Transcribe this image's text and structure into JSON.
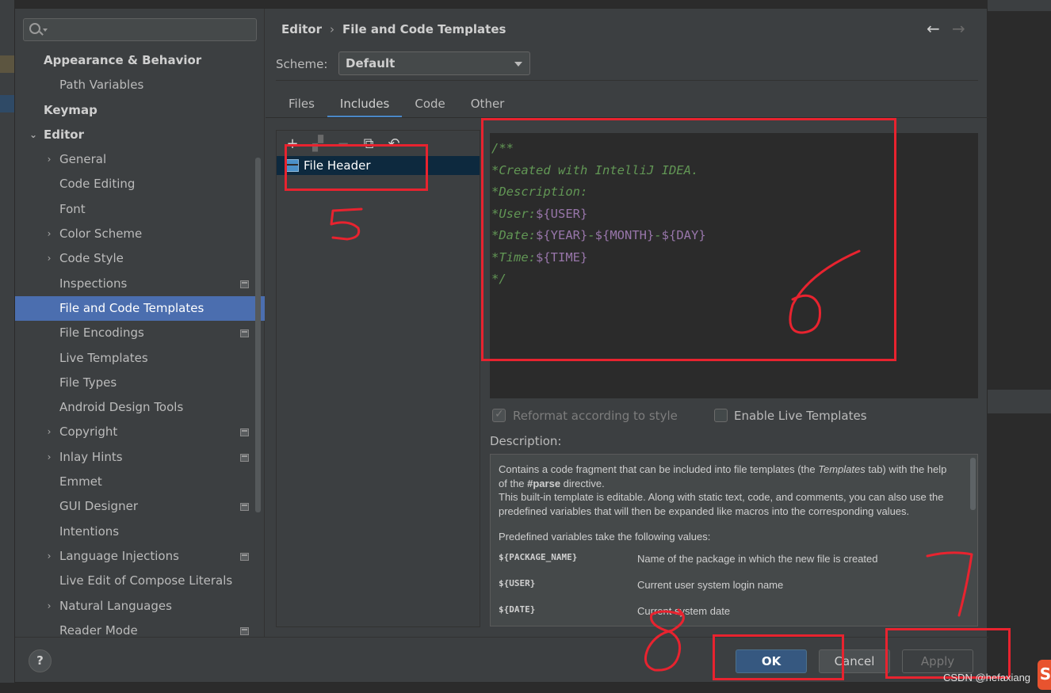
{
  "search": {
    "placeholder": ""
  },
  "sidebar": {
    "items": [
      {
        "label": "Appearance & Behavior",
        "level": 0,
        "arrow": "",
        "proj": false
      },
      {
        "label": "Path Variables",
        "level": 1,
        "arrow": "",
        "proj": false
      },
      {
        "label": "Keymap",
        "level": 0,
        "arrow": "",
        "proj": false
      },
      {
        "label": "Editor",
        "level": 0,
        "arrow": "⌄",
        "proj": false
      },
      {
        "label": "General",
        "level": 1,
        "arrow": "›",
        "proj": false
      },
      {
        "label": "Code Editing",
        "level": 1,
        "arrow": "",
        "proj": false
      },
      {
        "label": "Font",
        "level": 1,
        "arrow": "",
        "proj": false
      },
      {
        "label": "Color Scheme",
        "level": 1,
        "arrow": "›",
        "proj": false
      },
      {
        "label": "Code Style",
        "level": 1,
        "arrow": "›",
        "proj": false
      },
      {
        "label": "Inspections",
        "level": 1,
        "arrow": "",
        "proj": true
      },
      {
        "label": "File and Code Templates",
        "level": 1,
        "arrow": "",
        "proj": false,
        "selected": true
      },
      {
        "label": "File Encodings",
        "level": 1,
        "arrow": "",
        "proj": true
      },
      {
        "label": "Live Templates",
        "level": 1,
        "arrow": "",
        "proj": false
      },
      {
        "label": "File Types",
        "level": 1,
        "arrow": "",
        "proj": false
      },
      {
        "label": "Android Design Tools",
        "level": 1,
        "arrow": "",
        "proj": false
      },
      {
        "label": "Copyright",
        "level": 1,
        "arrow": "›",
        "proj": true
      },
      {
        "label": "Inlay Hints",
        "level": 1,
        "arrow": "›",
        "proj": true
      },
      {
        "label": "Emmet",
        "level": 1,
        "arrow": "",
        "proj": false
      },
      {
        "label": "GUI Designer",
        "level": 1,
        "arrow": "",
        "proj": true
      },
      {
        "label": "Intentions",
        "level": 1,
        "arrow": "",
        "proj": false
      },
      {
        "label": "Language Injections",
        "level": 1,
        "arrow": "›",
        "proj": true
      },
      {
        "label": "Live Edit of Compose Literals",
        "level": 1,
        "arrow": "",
        "proj": false
      },
      {
        "label": "Natural Languages",
        "level": 1,
        "arrow": "›",
        "proj": false
      },
      {
        "label": "Reader Mode",
        "level": 1,
        "arrow": "",
        "proj": true
      }
    ]
  },
  "header": {
    "crumb1": "Editor",
    "sep": "›",
    "crumb2": "File and Code Templates",
    "back": "←",
    "forward": "→"
  },
  "scheme": {
    "label": "Scheme:",
    "value": "Default"
  },
  "tabs": [
    "Files",
    "Includes",
    "Code",
    "Other"
  ],
  "toolbar": {
    "add": "+",
    "copy_disabled": "▞",
    "remove": "−",
    "duplicate": "⧉",
    "reset": "↶"
  },
  "list": {
    "selected_item": "File Header"
  },
  "editor": {
    "lines": [
      [
        {
          "t": "/**",
          "k": "comment"
        }
      ],
      [
        {
          "t": "*Created with IntelliJ IDEA.",
          "k": "comment"
        }
      ],
      [
        {
          "t": "*Description:",
          "k": "comment"
        }
      ],
      [
        {
          "t": "*User:",
          "k": "comment"
        },
        {
          "t": "${USER}",
          "k": "var"
        }
      ],
      [
        {
          "t": "*Date:",
          "k": "comment"
        },
        {
          "t": "${YEAR}",
          "k": "var"
        },
        {
          "t": "-",
          "k": "comment"
        },
        {
          "t": "${MONTH}",
          "k": "var"
        },
        {
          "t": "-",
          "k": "comment"
        },
        {
          "t": "${DAY}",
          "k": "var"
        }
      ],
      [
        {
          "t": "*Time:",
          "k": "comment"
        },
        {
          "t": "${TIME}",
          "k": "var"
        }
      ],
      [
        {
          "t": "*/",
          "k": "comment"
        }
      ]
    ]
  },
  "options": {
    "reformat": "Reformat according to style",
    "reformat_checked": true,
    "live": "Enable Live Templates",
    "live_checked": false
  },
  "description": {
    "label": "Description:",
    "p1_a": "Contains a code fragment that can be included into file templates (the ",
    "p1_em": "Templates",
    "p1_b": " tab) with the help of the ",
    "p1_strong": "#parse",
    "p1_c": " directive.",
    "p2": "This built-in template is editable. Along with static text, code, and comments, you can also use the predefined variables that will then be expanded like macros into the corresponding values.",
    "p3": "Predefined variables take the following values:",
    "vars": [
      {
        "name": "${PACKAGE_NAME}",
        "desc": "Name of the package in which the new file is created"
      },
      {
        "name": "${USER}",
        "desc": "Current user system login name"
      },
      {
        "name": "${DATE}",
        "desc": "Current system date"
      }
    ]
  },
  "footer": {
    "help": "?",
    "ok": "OK",
    "cancel": "Cancel",
    "apply": "Apply"
  },
  "annotations": {
    "n5": "5",
    "n6": "6",
    "n7": "7",
    "n8": "8",
    "color": "#e8232f"
  },
  "watermark": "CSDN @hefaxiang",
  "logo": "S"
}
